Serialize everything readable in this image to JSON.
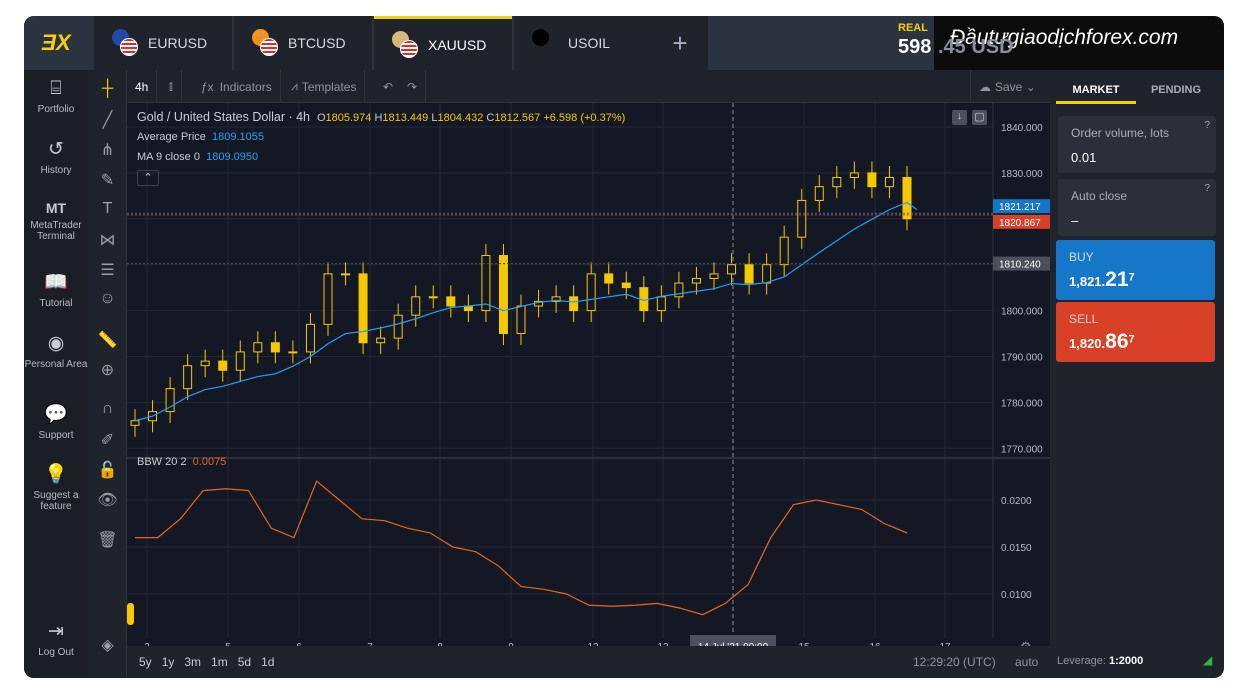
{
  "tabs": [
    {
      "label": "EURUSD",
      "c1": "#1f4aa8"
    },
    {
      "label": "BTCUSD",
      "c1": "#f29321"
    },
    {
      "label": "XAUUSD",
      "c1": "#d6b775",
      "active": true
    },
    {
      "label": "USOIL",
      "c1": "#000000"
    }
  ],
  "add_tab": "+",
  "account": {
    "type": "REAL",
    "balance": "598",
    "balance_hidden": ".45 USD"
  },
  "watermark": "Đầutưgiaodịchforex.com",
  "sidebar": [
    {
      "icon": "briefcase-icon",
      "glyph": "⌸",
      "label": "Portfolio"
    },
    {
      "icon": "history-icon",
      "glyph": "↺",
      "label": "History"
    },
    {
      "icon": "metatrader-icon",
      "glyph": "MT",
      "label": "MetaTrader Terminal"
    },
    {
      "icon": "book-icon",
      "glyph": "📖",
      "label": "Tutorial"
    },
    {
      "icon": "person-icon",
      "glyph": "◉",
      "label": "Personal Area"
    },
    {
      "icon": "chat-icon",
      "glyph": "💬",
      "label": "Support"
    },
    {
      "icon": "bulb-icon",
      "glyph": "💡",
      "label": "Suggest a feature"
    },
    {
      "icon": "logout-icon",
      "glyph": "⇥",
      "label": "Log Out"
    }
  ],
  "toolbar": {
    "interval": "4h",
    "indicators": "Indicators",
    "templates": "Templates",
    "save": "Save"
  },
  "legend": {
    "symbol": "Gold / United States Dollar · 4h",
    "o": "1805.974",
    "h": "1813.449",
    "l": "1804.432",
    "c": "1812.567",
    "chg": "+6.598 (+0.37%)",
    "avg_label": "Average Price",
    "avg_val": "1809.1055",
    "ma_label": "MA 9 close 0",
    "ma_val": "1809.0950",
    "bbw_label": "BBW 20 2",
    "bbw_val": "0.0075"
  },
  "chart_data": {
    "type": "candlestick",
    "price_ticks": [
      "1840.000",
      "1830.000",
      "1820.000",
      "1810.000",
      "1800.000",
      "1790.000",
      "1780.000",
      "1770.000"
    ],
    "price_range": [
      1765,
      1840
    ],
    "price_labels": {
      "buy": "1821.217",
      "sell": "1820.867",
      "avg": "1810.240"
    },
    "closes": [
      1776,
      1778,
      1783,
      1788,
      1789,
      1787,
      1791,
      1793,
      1791,
      1791,
      1797,
      1808,
      1808,
      1793,
      1794,
      1799,
      1803,
      1803,
      1801,
      1800,
      1812,
      1795,
      1801,
      1802,
      1803,
      1800,
      1808,
      1806,
      1805,
      1800,
      1803,
      1806,
      1807,
      1808,
      1810,
      1806,
      1810,
      1816,
      1824,
      1827,
      1829,
      1830,
      1827,
      1829,
      1820
    ],
    "first_open": 1775,
    "bbw_ticks": [
      "0.0200",
      "0.0150",
      "0.0100"
    ],
    "bbw_range": [
      0.007,
      0.023
    ],
    "bbw": [
      0.016,
      0.016,
      0.018,
      0.021,
      0.0212,
      0.021,
      0.017,
      0.016,
      0.022,
      0.02,
      0.018,
      0.0178,
      0.017,
      0.0165,
      0.015,
      0.0145,
      0.013,
      0.0108,
      0.0105,
      0.01,
      0.0088,
      0.0087,
      0.0088,
      0.009,
      0.0085,
      0.0078,
      0.009,
      0.011,
      0.016,
      0.0195,
      0.02,
      0.0195,
      0.019,
      0.0175,
      0.0165
    ],
    "x_labels": [
      "2",
      "5",
      "6",
      "7",
      "8",
      "9",
      "12",
      "13",
      "14 Jul '21   00:00",
      "15",
      "16",
      "17"
    ],
    "colors": {
      "candle": "#f5c800",
      "ma": "#2a9df4",
      "bbw": "#e8661c",
      "buy": "#1677c8",
      "sell": "#d84128"
    }
  },
  "ranges": [
    "5y",
    "1y",
    "3m",
    "1m",
    "5d",
    "1d"
  ],
  "status": {
    "time": "12:29:20 (UTC)",
    "scale": "auto",
    "leverage_label": "Leverage:",
    "leverage": "1:2000"
  },
  "order": {
    "tabs": [
      "MARKET",
      "PENDING"
    ],
    "volume_label": "Order volume, lots",
    "volume": "0.01",
    "autoclose_label": "Auto close",
    "autoclose": "–",
    "buy": {
      "label": "BUY",
      "pre": "1,821.",
      "big": "21",
      "sup": "7"
    },
    "sell": {
      "label": "SELL",
      "pre": "1,820.",
      "big": "86",
      "sup": "7"
    }
  }
}
